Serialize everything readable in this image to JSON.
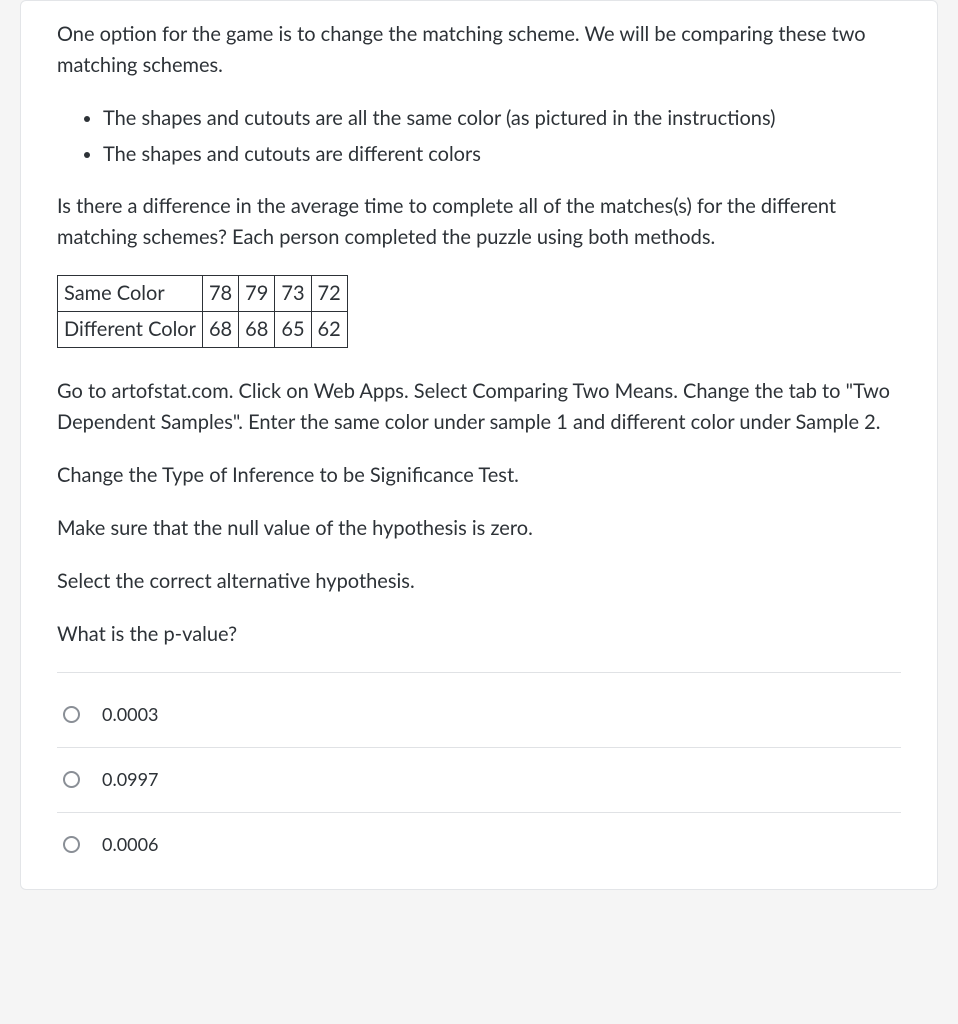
{
  "intro": "One option for the game is to change the matching scheme. We will be comparing these two matching schemes.",
  "bullets": [
    "The shapes and cutouts are all the same color (as pictured in the instructions)",
    "The shapes and cutouts are different colors"
  ],
  "question_intro": "Is there a difference in the average time to complete all of the matches(s) for the different matching schemes? Each person completed the puzzle using both methods.",
  "table": {
    "rows": [
      {
        "label": "Same Color",
        "v1": "78",
        "v2": "79",
        "v3": "73",
        "v4": "72"
      },
      {
        "label": "Different Color",
        "v1": "68",
        "v2": "68",
        "v3": "65",
        "v4": "62"
      }
    ]
  },
  "instructions": [
    "Go to artofstat.com. Click on Web Apps. Select Comparing Two Means. Change the tab to \"Two Dependent Samples\". Enter the same color under sample 1 and different color under Sample 2.",
    "Change the Type of Inference to be Significance Test.",
    "Make sure that the null value of the hypothesis is zero.",
    "Select the correct alternative hypothesis.",
    "What is the p-value?"
  ],
  "answers": [
    "0.0003",
    "0.0997",
    "0.0006"
  ]
}
